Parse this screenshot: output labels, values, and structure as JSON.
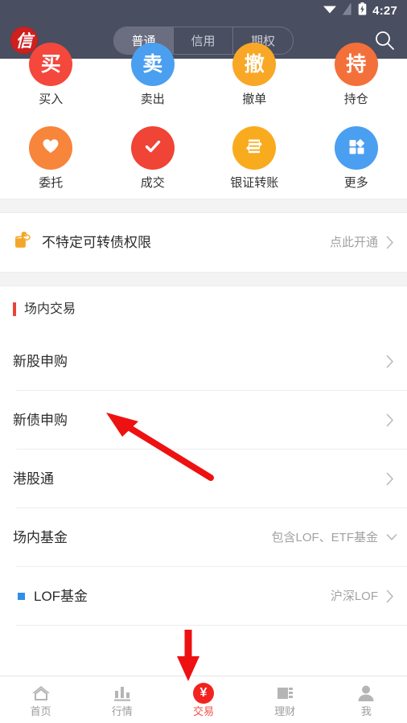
{
  "status_bar": {
    "time": "4:27",
    "icons": [
      "wifi-icon",
      "signal-icon",
      "battery-charging-icon"
    ]
  },
  "header": {
    "logo_char": "信",
    "logo_color": "#cf1f1f",
    "background": "#4a4e61",
    "tabs": [
      {
        "label": "普通",
        "active": true
      },
      {
        "label": "信用",
        "active": false
      },
      {
        "label": "期权",
        "active": false
      }
    ],
    "search_icon": "search-icon"
  },
  "quick_actions": [
    {
      "glyph": "买",
      "label": "买入",
      "color": "#f4483c",
      "icon": "text-glyph"
    },
    {
      "glyph": "卖",
      "label": "卖出",
      "color": "#4a9ff0",
      "icon": "text-glyph"
    },
    {
      "glyph": "撤",
      "label": "撤单",
      "color": "#f9a726",
      "icon": "text-glyph"
    },
    {
      "glyph": "持",
      "label": "持仓",
      "color": "#f4703a",
      "icon": "text-glyph"
    },
    {
      "glyph": "",
      "label": "委托",
      "color": "#f7853c",
      "icon": "heart-icon"
    },
    {
      "glyph": "",
      "label": "成交",
      "color": "#ef4436",
      "icon": "check-icon"
    },
    {
      "glyph": "",
      "label": "银证转账",
      "color": "#f9ab1e",
      "icon": "transfer-icon"
    },
    {
      "glyph": "",
      "label": "更多",
      "color": "#4a9ff0",
      "icon": "grid-more-icon"
    }
  ],
  "permission_banner": {
    "icon": "pointing-hand-icon",
    "title": "不特定可转债权限",
    "action_label": "点此开通",
    "chevron": "chevron-right-icon"
  },
  "section": {
    "title": "场内交易",
    "accent": "#e8443a"
  },
  "list": [
    {
      "title": "新股申购",
      "value": "",
      "chevron": "chevron-right-icon",
      "sub": false
    },
    {
      "title": "新债申购",
      "value": "",
      "chevron": "chevron-right-icon",
      "sub": false
    },
    {
      "title": "港股通",
      "value": "",
      "chevron": "chevron-right-icon",
      "sub": false
    },
    {
      "title": "场内基金",
      "value": "包含LOF、ETF基金",
      "chevron": "chevron-down-icon",
      "sub": false
    },
    {
      "title": "LOF基金",
      "value": "沪深LOF",
      "chevron": "chevron-right-icon",
      "sub": true
    }
  ],
  "bottom_nav": [
    {
      "label": "首页",
      "icon": "home-icon",
      "active": false
    },
    {
      "label": "行情",
      "icon": "bar-chart-icon",
      "active": false
    },
    {
      "label": "交易",
      "icon": "yen-trade-icon",
      "active": true
    },
    {
      "label": "理财",
      "icon": "finance-card-icon",
      "active": false
    },
    {
      "label": "我",
      "icon": "person-icon",
      "active": false
    }
  ],
  "annotations": [
    {
      "name": "arrow-to-new-stock-subscription",
      "color": "#ee1111"
    },
    {
      "name": "arrow-to-trade-tab",
      "color": "#ee1111"
    }
  ]
}
